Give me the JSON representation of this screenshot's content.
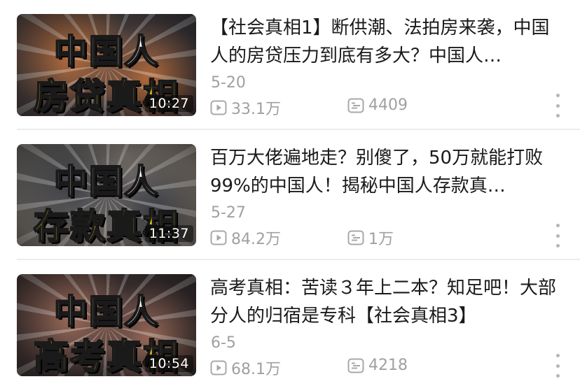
{
  "videos": [
    {
      "cover_top": "中国人",
      "cover_bottom": "房贷真相",
      "cover_colors": [
        "#5a4a44",
        "#b56b3a",
        "#2c2f3a"
      ],
      "duration": "10:27",
      "title": "【社会真相1】断供潮、法拍房来袭，中国人的房贷压力到底有多大？中国人…",
      "date": "5-20",
      "views": "33.1万",
      "comments": "4409",
      "view_icon": "play-count-icon",
      "comment_icon": "danmaku-count-icon",
      "more_icon": "more-vertical-icon"
    },
    {
      "cover_top": "中国人",
      "cover_bottom": "存款真相",
      "cover_colors": [
        "#6d6a66",
        "#3b3e45",
        "#8a7f74"
      ],
      "duration": "11:37",
      "title": "百万大佬遍地走？别傻了，50万就能打败99%的中国人！揭秘中国人存款真…",
      "date": "5-27",
      "views": "84.2万",
      "comments": "1万",
      "view_icon": "play-count-icon",
      "comment_icon": "danmaku-count-icon",
      "more_icon": "more-vertical-icon"
    },
    {
      "cover_top": "中国人",
      "cover_bottom": "高考真相",
      "cover_colors": [
        "#4a3a38",
        "#9a6a58",
        "#2f2a2c"
      ],
      "duration": "10:54",
      "title": "高考真相：苦读３年上二本？知足吧！大部分人的归宿是专科【社会真相3】",
      "date": "6-5",
      "views": "68.1万",
      "comments": "4218",
      "view_icon": "play-count-icon",
      "comment_icon": "danmaku-count-icon",
      "more_icon": "more-vertical-icon"
    }
  ]
}
